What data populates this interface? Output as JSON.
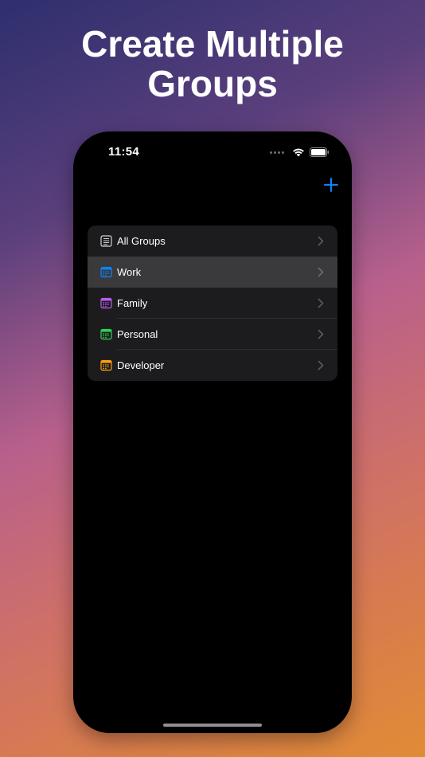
{
  "headline": {
    "line1": "Create Multiple",
    "line2": "Groups"
  },
  "status_bar": {
    "time": "11:54",
    "icons": [
      "signal-dots-icon",
      "wifi-icon",
      "battery-icon"
    ]
  },
  "toolbar": {
    "add_icon": "plus-icon",
    "accent_color": "#0a84ff"
  },
  "groups": [
    {
      "label": "All Groups",
      "icon": "list-icon",
      "color": "#d1d1d6",
      "selected": false
    },
    {
      "label": "Work",
      "icon": "calendar-icon",
      "color": "#0a84ff",
      "selected": true
    },
    {
      "label": "Family",
      "icon": "calendar-icon",
      "color": "#bf5af2",
      "selected": false
    },
    {
      "label": "Personal",
      "icon": "calendar-icon",
      "color": "#30d158",
      "selected": false
    },
    {
      "label": "Developer",
      "icon": "calendar-icon",
      "color": "#ff9f0a",
      "selected": false
    }
  ]
}
